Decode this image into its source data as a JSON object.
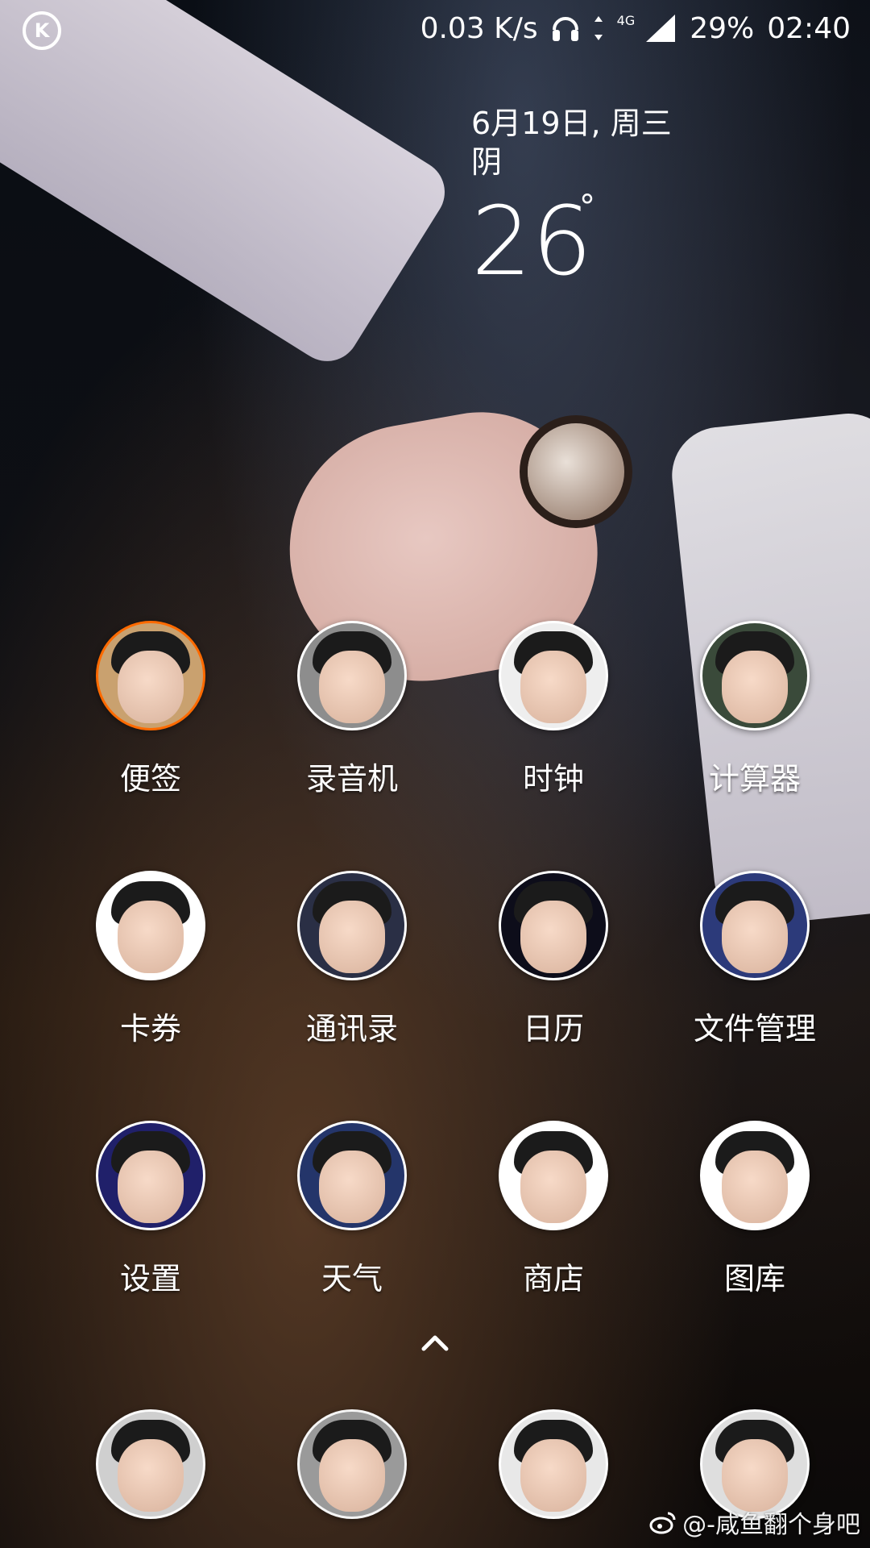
{
  "status_bar": {
    "badge_letter": "K",
    "speed": "0.03 K/s",
    "network_type": "4G",
    "battery": "29%",
    "time": "02:40",
    "icons": [
      "headset-icon",
      "data-arrows-icon",
      "signal-icon"
    ]
  },
  "weather_widget": {
    "date": "6月19日, 周三",
    "condition": "阴",
    "temperature": "26",
    "degree_symbol": "°"
  },
  "apps": [
    {
      "label": "便签",
      "avatar_bg": "#c9a16f",
      "ring": "#ff6a00"
    },
    {
      "label": "录音机",
      "avatar_bg": "#8d8d8d",
      "ring": "#ffffff"
    },
    {
      "label": "时钟",
      "avatar_bg": "#eeeeee",
      "ring": "#ffffff"
    },
    {
      "label": "计算器",
      "avatar_bg": "#3a4a3a",
      "ring": "#ffffff"
    },
    {
      "label": "卡券",
      "avatar_bg": "#ffffff",
      "ring": "#ffffff"
    },
    {
      "label": "通讯录",
      "avatar_bg": "#2a2f45",
      "ring": "#ffffff"
    },
    {
      "label": "日历",
      "avatar_bg": "#0d0d1a",
      "ring": "#ffffff"
    },
    {
      "label": "文件管理",
      "avatar_bg": "#2c3a7a",
      "ring": "#ffffff"
    },
    {
      "label": "设置",
      "avatar_bg": "#20206a",
      "ring": "#ffffff"
    },
    {
      "label": "天气",
      "avatar_bg": "#24356a",
      "ring": "#ffffff"
    },
    {
      "label": "商店",
      "avatar_bg": "#ffffff",
      "ring": "#ffffff"
    },
    {
      "label": "图库",
      "avatar_bg": "#ffffff",
      "ring": "#ffffff"
    }
  ],
  "dock": [
    {
      "label": "",
      "avatar_bg": "#cfcfcf"
    },
    {
      "label": "",
      "avatar_bg": "#9a9a9a"
    },
    {
      "label": "",
      "avatar_bg": "#e8e8e8"
    },
    {
      "label": "",
      "avatar_bg": "#dedede"
    }
  ],
  "watermark": {
    "icon": "weibo-icon",
    "text": "@-咸鱼翻个身吧"
  }
}
